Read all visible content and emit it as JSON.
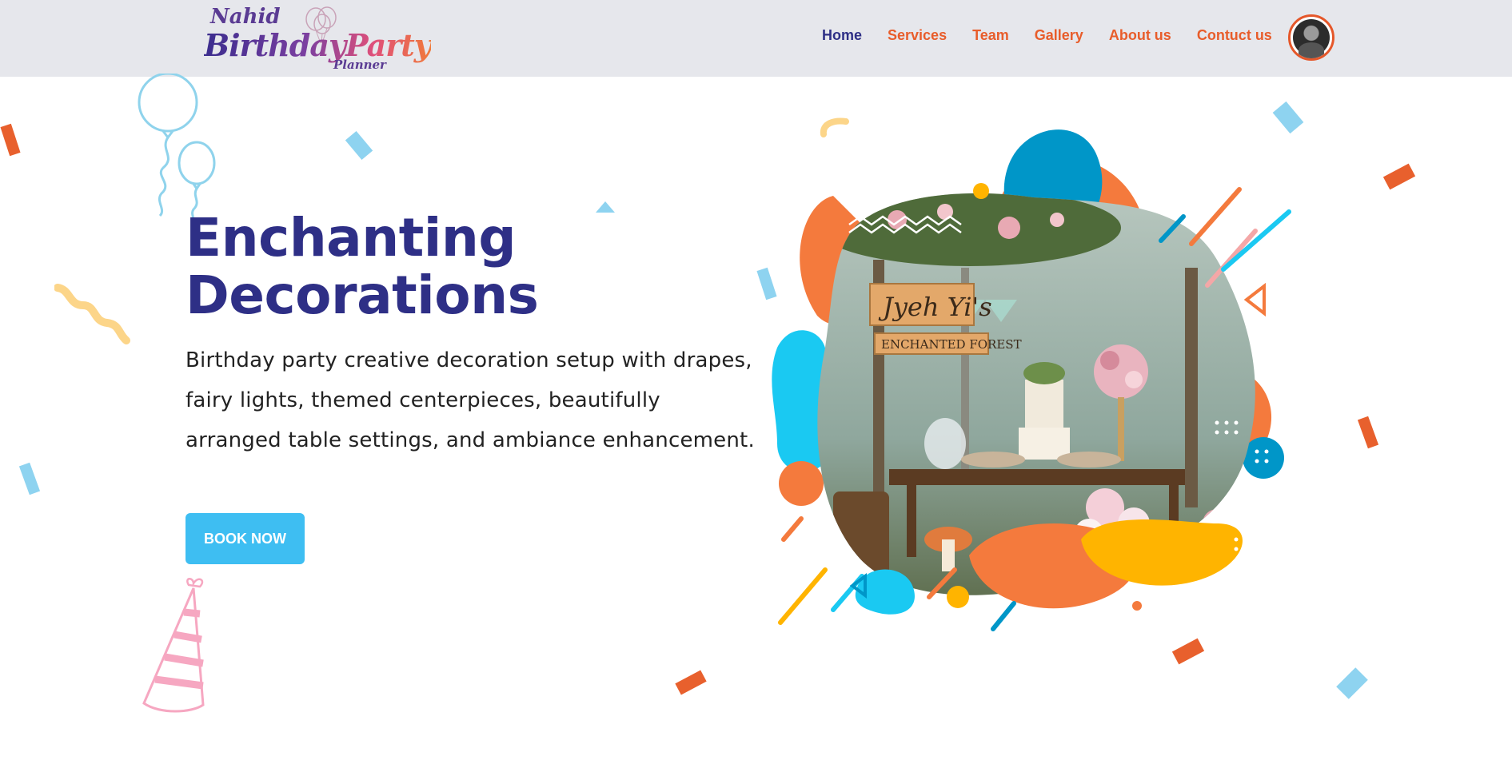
{
  "header": {
    "logo": {
      "line1": "Nahid",
      "line2": "BirthdayParty",
      "line3": "Planner"
    },
    "nav": [
      {
        "label": "Home",
        "active": true
      },
      {
        "label": "Services",
        "active": false
      },
      {
        "label": "Team",
        "active": false
      },
      {
        "label": "Gallery",
        "active": false
      },
      {
        "label": "About us",
        "active": false
      },
      {
        "label": "Contuct us",
        "active": false
      }
    ],
    "avatar_icon": "user-avatar"
  },
  "hero": {
    "title_line1": "Enchanting",
    "title_line2": "Decorations",
    "description": "Birthday party creative decoration setup with drapes, fairy lights, themed centerpieces, beautifully arranged table settings, and ambiance enhancement.",
    "button_label": "BOOK NOW",
    "sign_top": "Jyeh Yi's",
    "sign_bottom": "ENCHANTED FOREST"
  },
  "colors": {
    "nav_text": "#e85d2b",
    "nav_active": "#2e2f86",
    "title": "#2e2f86",
    "button": "#3ebef2",
    "header_bg": "#e6e7ec",
    "orange": "#f47a3d",
    "blue": "#0096c8",
    "cyan": "#1ac9f2",
    "yellow": "#ffb400"
  }
}
